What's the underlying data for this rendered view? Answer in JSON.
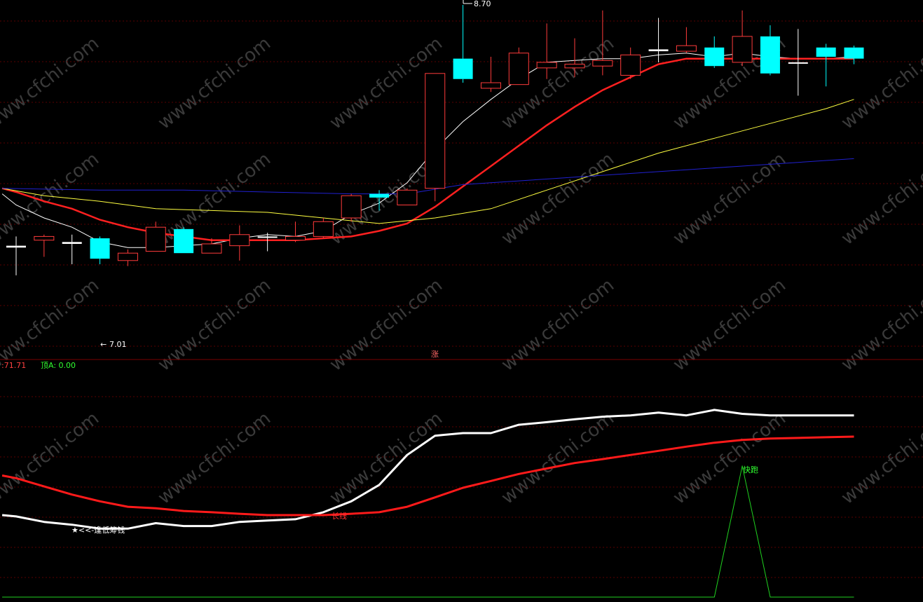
{
  "colors": {
    "background": "#000000",
    "grid": "#5a0000",
    "divider": "#7a0000",
    "candle_up": "#ff3b3b",
    "candle_down": "#00ffff",
    "doji": "#ffffff",
    "ma_short": "#ffffff",
    "ma_mid": "#ff2020",
    "ma_long": "#ffff40",
    "ma_longer": "#2020d0",
    "osc_fast": "#ffffff",
    "osc_slow": "#ff1a1a",
    "signal": "#1fd11f",
    "label_green": "#30ff30",
    "label_red": "#ff4040"
  },
  "watermark": "www.cfchi.com",
  "upper_panel": {
    "high_marker": "8.70",
    "low_marker": "7.01",
    "center_badge": "涨"
  },
  "lower_panel": {
    "left_value": ":71.71",
    "top_a_label": "顶A: 0.00",
    "note_low": "★<<-逢低筹钱",
    "note_cross": "长线",
    "note_peak": "快跑"
  },
  "chart_data": [
    {
      "type": "candlestick",
      "ylim": [
        6.9,
        8.75
      ],
      "grid": true,
      "candles": [
        {
          "o": 7.45,
          "h": 7.5,
          "l": 7.29,
          "c": 7.44
        },
        {
          "o": 7.48,
          "h": 7.51,
          "l": 7.39,
          "c": 7.5
        },
        {
          "o": 7.47,
          "h": 7.51,
          "l": 7.35,
          "c": 7.46
        },
        {
          "o": 7.49,
          "h": 7.5,
          "l": 7.35,
          "c": 7.38
        },
        {
          "o": 7.37,
          "h": 7.43,
          "l": 7.34,
          "c": 7.41
        },
        {
          "o": 7.42,
          "h": 7.58,
          "l": 7.42,
          "c": 7.55
        },
        {
          "o": 7.54,
          "h": 7.55,
          "l": 7.41,
          "c": 7.41
        },
        {
          "o": 7.41,
          "h": 7.49,
          "l": 7.41,
          "c": 7.46
        },
        {
          "o": 7.45,
          "h": 7.56,
          "l": 7.37,
          "c": 7.51
        },
        {
          "o": 7.5,
          "h": 7.52,
          "l": 7.42,
          "c": 7.5
        },
        {
          "o": 7.48,
          "h": 7.58,
          "l": 7.47,
          "c": 7.5
        },
        {
          "o": 7.5,
          "h": 7.6,
          "l": 7.49,
          "c": 7.58
        },
        {
          "o": 7.6,
          "h": 7.73,
          "l": 7.58,
          "c": 7.72
        },
        {
          "o": 7.73,
          "h": 7.75,
          "l": 7.64,
          "c": 7.71
        },
        {
          "o": 7.67,
          "h": 7.76,
          "l": 7.67,
          "c": 7.75
        },
        {
          "o": 7.76,
          "h": 8.38,
          "l": 7.69,
          "c": 8.38
        },
        {
          "o": 8.46,
          "h": 8.75,
          "l": 8.33,
          "c": 8.35
        },
        {
          "o": 8.3,
          "h": 8.47,
          "l": 8.28,
          "c": 8.33
        },
        {
          "o": 8.32,
          "h": 8.52,
          "l": 8.32,
          "c": 8.49
        },
        {
          "o": 8.41,
          "h": 8.65,
          "l": 8.35,
          "c": 8.44
        },
        {
          "o": 8.41,
          "h": 8.57,
          "l": 8.36,
          "c": 8.43
        },
        {
          "o": 8.42,
          "h": 8.72,
          "l": 8.37,
          "c": 8.45
        },
        {
          "o": 8.37,
          "h": 8.52,
          "l": 8.35,
          "c": 8.48
        },
        {
          "o": 8.51,
          "h": 8.68,
          "l": 8.44,
          "c": 8.5
        },
        {
          "o": 8.5,
          "h": 8.63,
          "l": 8.49,
          "c": 8.53
        },
        {
          "o": 8.52,
          "h": 8.58,
          "l": 8.41,
          "c": 8.42
        },
        {
          "o": 8.44,
          "h": 8.72,
          "l": 8.42,
          "c": 8.58
        },
        {
          "o": 8.58,
          "h": 8.64,
          "l": 8.37,
          "c": 8.38
        },
        {
          "o": 8.44,
          "h": 8.62,
          "l": 8.26,
          "c": 8.44
        },
        {
          "o": 8.52,
          "h": 8.54,
          "l": 8.31,
          "c": 8.47
        },
        {
          "o": 8.52,
          "h": 8.53,
          "l": 8.43,
          "c": 8.46
        }
      ],
      "ma_lines": [
        {
          "name": "MA-short",
          "points": [
            [
              -0.5,
              7.73
            ],
            [
              0,
              7.67
            ],
            [
              1,
              7.6
            ],
            [
              2,
              7.55
            ],
            [
              3,
              7.47
            ],
            [
              4,
              7.44
            ],
            [
              5,
              7.44
            ],
            [
              6,
              7.45
            ],
            [
              7,
              7.46
            ],
            [
              8,
              7.49
            ],
            [
              9,
              7.51
            ],
            [
              10,
              7.5
            ],
            [
              11,
              7.53
            ],
            [
              12,
              7.62
            ],
            [
              13,
              7.68
            ],
            [
              14,
              7.79
            ],
            [
              15,
              7.97
            ],
            [
              16,
              8.12
            ],
            [
              17,
              8.24
            ],
            [
              18,
              8.35
            ],
            [
              19,
              8.44
            ],
            [
              20,
              8.45
            ],
            [
              21,
              8.46
            ],
            [
              22,
              8.46
            ],
            [
              23,
              8.48
            ],
            [
              24,
              8.49
            ],
            [
              25,
              8.47
            ],
            [
              26,
              8.49
            ],
            [
              27,
              8.47
            ],
            [
              28,
              8.46
            ],
            [
              29,
              8.46
            ],
            [
              30,
              8.47
            ]
          ]
        },
        {
          "name": "MA-mid",
          "points": [
            [
              -0.5,
              7.76
            ],
            [
              0,
              7.74
            ],
            [
              1,
              7.69
            ],
            [
              2,
              7.65
            ],
            [
              3,
              7.59
            ],
            [
              4,
              7.55
            ],
            [
              5,
              7.52
            ],
            [
              6,
              7.5
            ],
            [
              7,
              7.48
            ],
            [
              8,
              7.48
            ],
            [
              9,
              7.48
            ],
            [
              10,
              7.48
            ],
            [
              11,
              7.49
            ],
            [
              12,
              7.5
            ],
            [
              13,
              7.53
            ],
            [
              14,
              7.57
            ],
            [
              15,
              7.66
            ],
            [
              16,
              7.77
            ],
            [
              17,
              7.88
            ],
            [
              18,
              7.99
            ],
            [
              19,
              8.1
            ],
            [
              20,
              8.2
            ],
            [
              21,
              8.29
            ],
            [
              22,
              8.36
            ],
            [
              23,
              8.43
            ],
            [
              24,
              8.46
            ],
            [
              25,
              8.46
            ],
            [
              26,
              8.46
            ],
            [
              27,
              8.46
            ],
            [
              28,
              8.46
            ],
            [
              29,
              8.46
            ],
            [
              30,
              8.46
            ]
          ]
        },
        {
          "name": "MA-long",
          "points": [
            [
              -0.5,
              7.76
            ],
            [
              1,
              7.72
            ],
            [
              3,
              7.69
            ],
            [
              5,
              7.65
            ],
            [
              7,
              7.64
            ],
            [
              9,
              7.63
            ],
            [
              11,
              7.6
            ],
            [
              13,
              7.57
            ],
            [
              15,
              7.6
            ],
            [
              17,
              7.65
            ],
            [
              19,
              7.75
            ],
            [
              21,
              7.85
            ],
            [
              23,
              7.95
            ],
            [
              25,
              8.03
            ],
            [
              27,
              8.11
            ],
            [
              29,
              8.19
            ],
            [
              30,
              8.24
            ]
          ]
        },
        {
          "name": "MA-longer",
          "points": [
            [
              -0.5,
              7.76
            ],
            [
              3,
              7.75
            ],
            [
              6,
              7.75
            ],
            [
              9,
              7.74
            ],
            [
              12,
              7.73
            ],
            [
              14,
              7.73
            ],
            [
              16,
              7.78
            ],
            [
              18,
              7.8
            ],
            [
              20,
              7.82
            ],
            [
              22,
              7.84
            ],
            [
              24,
              7.86
            ],
            [
              26,
              7.88
            ],
            [
              28,
              7.9
            ],
            [
              30,
              7.92
            ]
          ]
        }
      ]
    },
    {
      "type": "line",
      "ylim": [
        0,
        100
      ],
      "grid": true,
      "x": [
        -0.5,
        0,
        1,
        2,
        3,
        4,
        5,
        6,
        7,
        8,
        9,
        10,
        11,
        12,
        13,
        14,
        15,
        16,
        17,
        18,
        19,
        20,
        21,
        22,
        23,
        24,
        25,
        26,
        27,
        28,
        29,
        30
      ],
      "series": [
        {
          "values": [
            37.5,
            36.9,
            34.4,
            33.1,
            31.3,
            31.3,
            33.8,
            32.5,
            32.5,
            34.4,
            35.0,
            35.6,
            38.8,
            43.8,
            51.3,
            65.0,
            73.8,
            75.0,
            75.0,
            78.8,
            80.0,
            81.3,
            82.5,
            83.1,
            84.4,
            83.1,
            85.6,
            83.8,
            83.1,
            83.1,
            83.1,
            83.1
          ]
        },
        {
          "values": [
            55.6,
            54.4,
            50.6,
            46.9,
            43.8,
            41.3,
            40.6,
            39.4,
            38.8,
            38.1,
            37.5,
            37.5,
            37.5,
            38.1,
            38.8,
            41.3,
            45.6,
            50.0,
            53.1,
            56.3,
            58.8,
            61.3,
            63.1,
            65.0,
            66.9,
            68.8,
            70.6,
            71.9,
            72.5,
            72.8,
            73.1,
            73.4
          ]
        },
        {
          "values": [
            0,
            0,
            0,
            0,
            0,
            0,
            0,
            0,
            0,
            0,
            0,
            0,
            0,
            0,
            0,
            0,
            0,
            0,
            0,
            0,
            0,
            0,
            0,
            0,
            0,
            0,
            0,
            60,
            0,
            0,
            0,
            0
          ]
        }
      ]
    }
  ]
}
